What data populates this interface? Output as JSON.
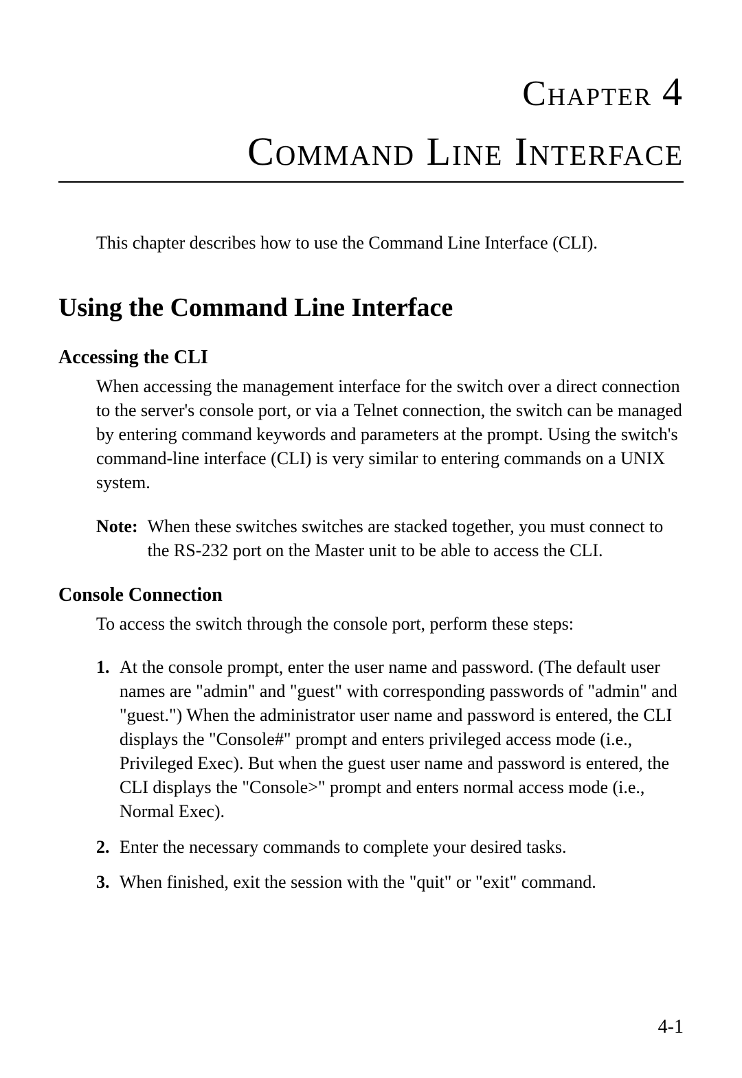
{
  "chapter": {
    "label_word": "Chapter",
    "label_number": "4",
    "title": "Command Line Interface"
  },
  "intro": "This chapter describes how to use the Command Line Interface (CLI).",
  "section1": {
    "heading": "Using the Command Line Interface",
    "sub1": {
      "heading": "Accessing the CLI",
      "para": "When accessing the management interface for the switch over a direct connection to the server's console port, or via a Telnet connection, the switch can be managed by entering command keywords and parameters at the prompt. Using the switch's command-line interface (CLI) is very similar to entering commands on a UNIX system.",
      "note_label": "Note:",
      "note_text": "When these switches switches are stacked together, you must connect to the RS-232 port on the Master unit to be able to access the CLI."
    },
    "sub2": {
      "heading": "Console Connection",
      "para": "To access the switch through the console port, perform these steps:",
      "steps": [
        "At the console prompt, enter the user name and password. (The default user names are \"admin\" and \"guest\" with corresponding passwords of \"admin\" and \"guest.\") When the administrator user name and password is entered, the CLI displays the \"Console#\" prompt and enters privileged access mode (i.e., Privileged Exec). But when the guest user name and password is entered, the CLI displays the \"Console>\" prompt and enters normal access mode (i.e., Normal Exec).",
        "Enter the necessary commands to complete your desired tasks.",
        "When finished, exit the session with the \"quit\" or \"exit\" command."
      ],
      "step_numbers": [
        "1.",
        "2.",
        "3."
      ]
    }
  },
  "page_number": "4-1"
}
